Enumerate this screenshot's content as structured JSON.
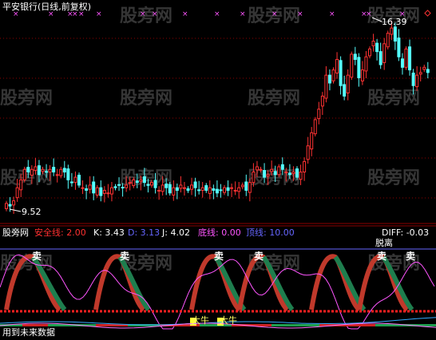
{
  "chart": {
    "title": "平安银行(日线,前复权)",
    "last_price": "16.39",
    "low_price": "9.52",
    "candle_closes": [
      9.7,
      9.6,
      9.8,
      10.3,
      10.6,
      11.0,
      10.9,
      11.0,
      11.1,
      10.8,
      11.0,
      10.9,
      11.0,
      10.9,
      10.8,
      11.0,
      10.9,
      10.6,
      10.5,
      10.7,
      10.4,
      10.3,
      10.2,
      10.4,
      10.1,
      10.3,
      10.0,
      10.2,
      10.1,
      10.3,
      10.3,
      10.4,
      10.3,
      10.4,
      10.5,
      10.6,
      10.5,
      10.6,
      10.5,
      10.4,
      10.5,
      10.3,
      10.2,
      10.4,
      10.3,
      10.1,
      10.3,
      10.2,
      10.4,
      10.3,
      10.2,
      10.4,
      10.3,
      10.2,
      10.3,
      10.2,
      10.3,
      10.2,
      10.1,
      10.2,
      10.3,
      10.2,
      10.3,
      10.2,
      10.3,
      10.4,
      10.2,
      10.5,
      10.9,
      11.1,
      11.0,
      10.7,
      10.8,
      11.0,
      10.8,
      11.1,
      11.0,
      10.9,
      10.8,
      10.9,
      10.7,
      10.9,
      11.3,
      11.9,
      12.4,
      12.9,
      13.3,
      13.8,
      14.6,
      14.3,
      14.8,
      15.2,
      14.2,
      13.8,
      14.6,
      15.4,
      15.2,
      14.5,
      14.8,
      15.3,
      15.6,
      15.9,
      15.5,
      15.0,
      15.8,
      16.2,
      16.4,
      15.9,
      15.3,
      14.9,
      15.6,
      14.8,
      14.2,
      14.6,
      14.7,
      14.9,
      14.7
    ]
  },
  "indicator": {
    "name": "股旁网",
    "safety_line": "安全线: 2.00",
    "k_value": "K: 3.43",
    "d_value": "D: 3.13",
    "j_value": "J: 4.02",
    "bottom_line": "底线: 0.00",
    "top_line": "顶线: 10.00",
    "diff_value": "DIFF: -0.03",
    "leave_tag": "脱离",
    "sell_tag": "卖",
    "bull_tag": "大牛",
    "footer_link": "用到未来数据"
  },
  "colors": {
    "up_candle": "#ff3232",
    "down_candle": "#54ffff",
    "safety_line": "#ff2020",
    "k_color": "#ffffff",
    "d_color": "#ffff55",
    "j_color": "#ff55ff",
    "bottom_color": "#ff55ff",
    "top_color": "#6666ff",
    "band_red": "#c0392b",
    "band_green": "#1e7e4e",
    "grid": "#8b0000"
  },
  "watermark": "股旁网"
}
